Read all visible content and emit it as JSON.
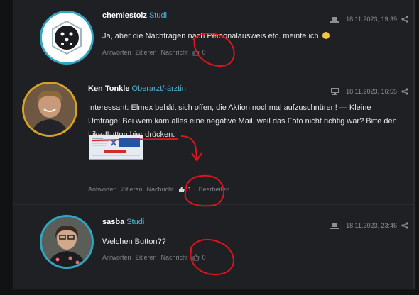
{
  "posts": [
    {
      "author": "chemiestolz",
      "rank": "Studi",
      "device_icon": "laptop-icon",
      "date": "18.11.2023, 19:39",
      "text": "Ja, aber die Nachfragen nach Personalausweis etc. meinte ich",
      "emoji": "smile-emoji",
      "actions": {
        "reply": "Antworten",
        "quote": "Zitieren",
        "message": "Nachricht",
        "likes": "0"
      }
    },
    {
      "author": "Ken Tonkle",
      "rank": "Oberarzt/-ärztin",
      "device_icon": "desktop-icon",
      "date": "18.11.2023, 16:55",
      "text": "Interessant: Elmex behält sich offen, die Aktion nochmal aufzuschnüren! — Kleine Umfrage: Bei wem kam alles eine negative Mail, weil das Foto nicht richtig war? Bitte den Like-Button hier drücken.",
      "actions": {
        "reply": "Antworten",
        "quote": "Zitieren",
        "message": "Nachricht",
        "likes": "1",
        "edit": "Bearbeiten"
      }
    },
    {
      "author": "sasba",
      "rank": "Studi",
      "device_icon": "laptop-icon",
      "date": "18.11.2023, 23:46",
      "text": "Welchen Button??",
      "actions": {
        "reply": "Antworten",
        "quote": "Zitieren",
        "message": "Nachricht",
        "likes": "0"
      }
    }
  ],
  "colors": {
    "background": "#1f2023",
    "accent": "#4fb5d6",
    "avatar_ring": "#2fa6c2",
    "annotation": "#e0131c"
  }
}
